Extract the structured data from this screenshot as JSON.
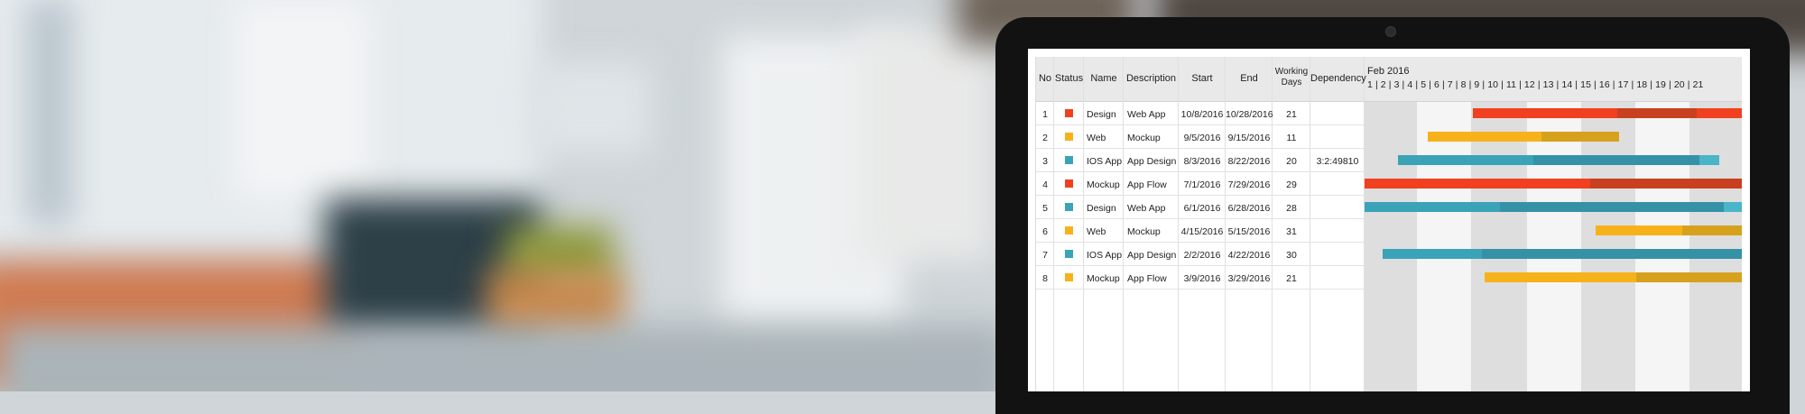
{
  "columns": {
    "no": "No",
    "status": "Status",
    "name": "Name",
    "description": "Description",
    "start": "Start",
    "end": "End",
    "working_days": "Working Days",
    "dependency": "Dependency"
  },
  "timeline": {
    "month": "Feb 2016",
    "days": "1 | 2 | 3 | 4 | 5 | 6 | 7 | 8 | 9 | 10 | 11 | 12 | 13 | 14 | 15 | 16 | 17 | 18 | 19 | 20 | 21"
  },
  "colors": {
    "red": "#f0401f",
    "yellow": "#f7b21b",
    "teal": "#3aa3b8"
  },
  "rows": [
    {
      "no": "1",
      "status_color": "red",
      "name": "Design",
      "description": "Web App",
      "start": "10/8/2016",
      "end": "10/28/2016",
      "working_days": "21",
      "dependency": ""
    },
    {
      "no": "2",
      "status_color": "yellow",
      "name": "Web",
      "description": "Mockup",
      "start": "9/5/2016",
      "end": "9/15/2016",
      "working_days": "11",
      "dependency": ""
    },
    {
      "no": "3",
      "status_color": "teal",
      "name": "IOS App",
      "description": "App Design",
      "start": "8/3/2016",
      "end": "8/22/2016",
      "working_days": "20",
      "dependency": "3:2:49810"
    },
    {
      "no": "4",
      "status_color": "red",
      "name": "Mockup",
      "description": "App Flow",
      "start": "7/1/2016",
      "end": "7/29/2016",
      "working_days": "29",
      "dependency": ""
    },
    {
      "no": "5",
      "status_color": "teal",
      "name": "Design",
      "description": "Web App",
      "start": "6/1/2016",
      "end": "6/28/2016",
      "working_days": "28",
      "dependency": ""
    },
    {
      "no": "6",
      "status_color": "yellow",
      "name": "Web",
      "description": "Mockup",
      "start": "4/15/2016",
      "end": "5/15/2016",
      "working_days": "31",
      "dependency": ""
    },
    {
      "no": "7",
      "status_color": "teal",
      "name": "IOS App",
      "description": "App Design",
      "start": "2/2/2016",
      "end": "4/22/2016",
      "working_days": "30",
      "dependency": ""
    },
    {
      "no": "8",
      "status_color": "yellow",
      "name": "Mockup",
      "description": "App Flow",
      "start": "3/9/2016",
      "end": "3/29/2016",
      "working_days": "21",
      "dependency": ""
    }
  ]
}
